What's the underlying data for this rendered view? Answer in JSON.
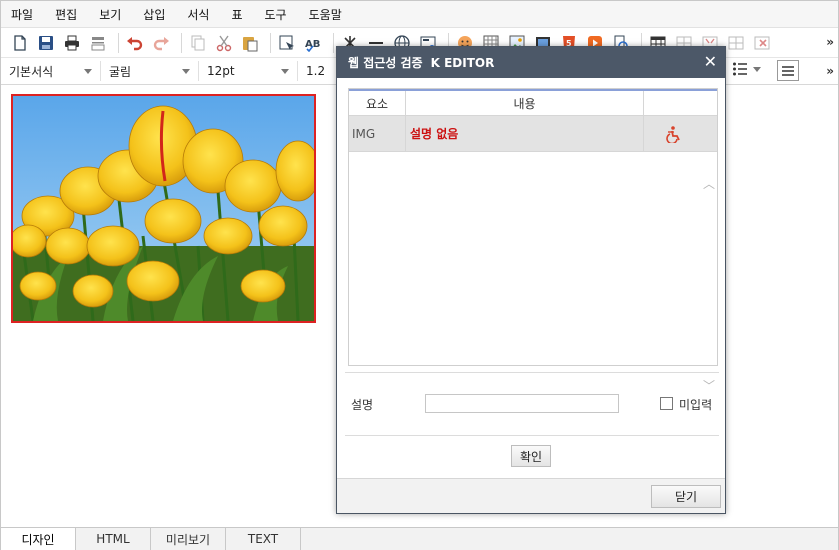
{
  "menu": [
    "파일",
    "편집",
    "보기",
    "삽입",
    "서식",
    "표",
    "도구",
    "도움말"
  ],
  "toolbar": {
    "icons": [
      "new-doc-icon",
      "save-icon",
      "print-icon",
      "print-preview-icon",
      "undo-icon",
      "redo-icon",
      "copy-icon",
      "cut-icon",
      "paste-icon",
      "select-icon",
      "spellcheck-icon",
      "special-char-icon",
      "hr-icon",
      "link-icon",
      "form-icon",
      "emoticon-icon",
      "pattern-icon",
      "image-icon",
      "media-icon",
      "html5-icon",
      "video-icon",
      "copy-format-icon",
      "table-icon",
      "merge-cell-icon",
      "split-cell-icon",
      "delete-cell-icon",
      "delete-table-icon"
    ],
    "more": "»"
  },
  "format": {
    "style": "기본서식",
    "font": "굴림",
    "size": "12pt",
    "line_height": "1.2",
    "more": "»"
  },
  "dialog": {
    "title": "웹 접근성 검증",
    "brand": "K EDITOR",
    "close": "✕",
    "columns": [
      "요소",
      "내용",
      ""
    ],
    "rows": [
      {
        "element": "IMG",
        "content": "설명 없음"
      }
    ],
    "desc_label": "설명",
    "desc_value": "",
    "no_input_label": "미입력",
    "confirm": "확인",
    "close_button": "닫기",
    "scroll_up": "︿",
    "scroll_down": "﹀"
  },
  "tabs": [
    "디자인",
    "HTML",
    "미리보기",
    "TEXT"
  ],
  "active_tab": 0,
  "colors": {
    "accent_red": "#cc1111",
    "dialog_title": "#4c5868",
    "image_border": "#dd2222"
  }
}
